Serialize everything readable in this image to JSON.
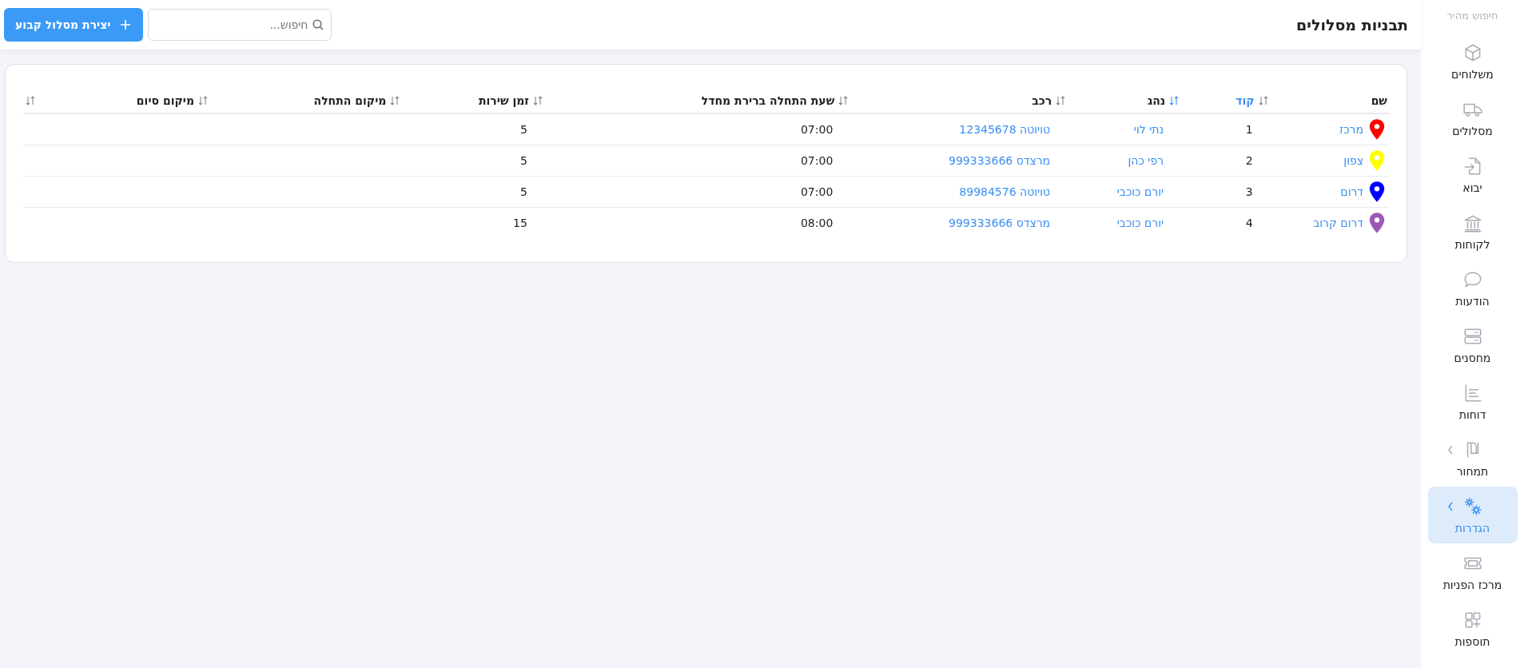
{
  "page_title": "תבניות מסלולים",
  "create_button": {
    "label": "יצירת מסלול קבוע"
  },
  "search": {
    "placeholder": "חיפוש..."
  },
  "sidebar": {
    "quick_search": "חיפוש מהיר",
    "items": [
      {
        "label": "משלוחים",
        "selected": false,
        "has_submenu": false
      },
      {
        "label": "מסלולים",
        "selected": false,
        "has_submenu": false
      },
      {
        "label": "יבוא",
        "selected": false,
        "has_submenu": false
      },
      {
        "label": "לקוחות",
        "selected": false,
        "has_submenu": false
      },
      {
        "label": "הודעות",
        "selected": false,
        "has_submenu": false
      },
      {
        "label": "מחסנים",
        "selected": false,
        "has_submenu": false
      },
      {
        "label": "דוחות",
        "selected": false,
        "has_submenu": false
      },
      {
        "label": "תמחור",
        "selected": false,
        "has_submenu": true
      },
      {
        "label": "הגדרות",
        "selected": true,
        "has_submenu": true
      },
      {
        "label": "מרכז הפניות",
        "selected": false,
        "has_submenu": false
      },
      {
        "label": "תוספות",
        "selected": false,
        "has_submenu": false
      }
    ]
  },
  "table": {
    "columns": [
      {
        "label": "שם",
        "sorted": false
      },
      {
        "label": "קוד",
        "sorted": true
      },
      {
        "label": "נהג",
        "sorted": false
      },
      {
        "label": "רכב",
        "sorted": false
      },
      {
        "label": "שעת התחלה ברירת מחדל",
        "sorted": false
      },
      {
        "label": "זמן שירות",
        "sorted": false
      },
      {
        "label": "מיקום התחלה",
        "sorted": false
      },
      {
        "label": "מיקום סיום",
        "sorted": false
      }
    ],
    "rows": [
      {
        "name": "מרכז",
        "color": "#ff0000",
        "code": "1",
        "driver": "נתי לוי",
        "vehicle": "טויוטה 12345678",
        "start_time": "07:00",
        "service_time": "5"
      },
      {
        "name": "צפון",
        "color": "#ffff00",
        "code": "2",
        "driver": "רפי כהן",
        "vehicle": "מרצדס 999333666",
        "start_time": "07:00",
        "service_time": "5"
      },
      {
        "name": "דרום",
        "color": "#0000ff",
        "code": "3",
        "driver": "יורם כוכבי",
        "vehicle": "טויוטה 89984576",
        "start_time": "07:00",
        "service_time": "5"
      },
      {
        "name": "דרום קרוב",
        "color": "#9b59b6",
        "code": "4",
        "driver": "יורם כוכבי",
        "vehicle": "מרצדס 999333666",
        "start_time": "08:00",
        "service_time": "15"
      }
    ]
  }
}
